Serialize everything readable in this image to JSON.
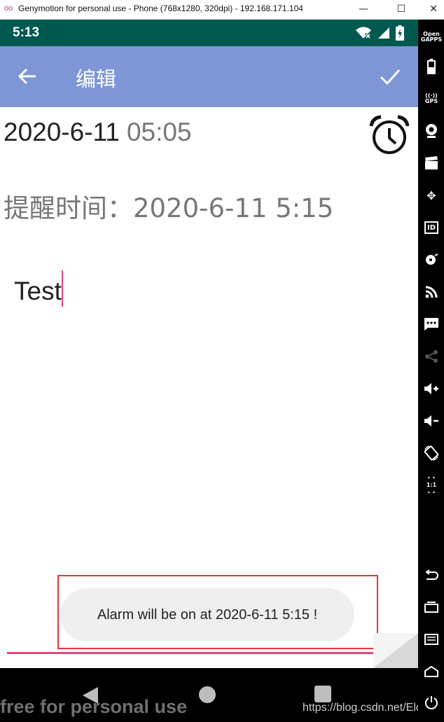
{
  "window": {
    "logo": "oo",
    "title": "Genymotion for personal use - Phone (768x1280, 320dpi) - 192.168.171.104",
    "minimize_glyph": "—",
    "maximize_glyph": "☐",
    "close_glyph": "✕"
  },
  "status_bar": {
    "time": "5:13",
    "icons": [
      "wifi-icon",
      "signal-icon",
      "battery-icon"
    ],
    "color": "#00594f"
  },
  "app_bar": {
    "title": "编辑",
    "color": "#7f96d6",
    "icons": [
      "back-arrow-icon",
      "checkmark-icon"
    ]
  },
  "note": {
    "date": "2020-6-11",
    "time": "05:05",
    "reminder": "提醒时间：2020-6-11 5:15",
    "content": "Test",
    "icons": [
      "alarm-clock-icon"
    ]
  },
  "toast": {
    "message": "Alarm will be on at 2020-6-11 5:15 !"
  },
  "nav_bar": {
    "icons": [
      "nav-back-icon",
      "nav-home-icon",
      "nav-recents-icon"
    ]
  },
  "watermark": {
    "text": "free for personal use",
    "url": "https://blog.csdn.net/Eldbro"
  },
  "sidebar": {
    "opengapps_line1": "Open",
    "opengapps_line2": "GAPPS",
    "gps_label": "GPS",
    "id_label": "ID",
    "scale_label": "1:1",
    "icons": [
      "opengapps-icon",
      "battery-icon",
      "gps-icon",
      "camera-icon",
      "media-icon",
      "move-icon",
      "id-icon",
      "disk-icon",
      "rss-icon",
      "sms-icon",
      "share-icon",
      "volume-up-icon",
      "volume-down-icon",
      "rotate-icon",
      "scale-icon",
      "back-icon",
      "recent-apps-icon",
      "menu-icon",
      "home-icon",
      "power-icon"
    ]
  },
  "colors": {
    "accent_pink": "#e8457a",
    "highlight_red": "#e0383c",
    "toast_bg": "#efefef"
  }
}
